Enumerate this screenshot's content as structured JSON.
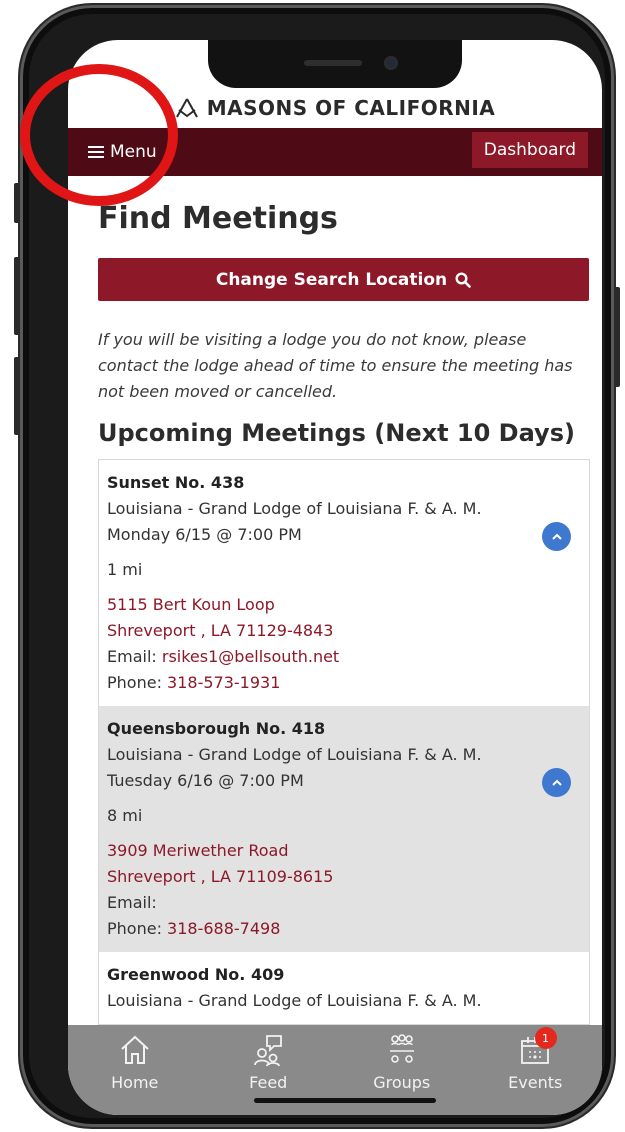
{
  "brand": {
    "logo_text": "MASONS OF CALIFORNIA",
    "accent": "#8c1828",
    "dark_accent": "#4f0b15"
  },
  "menu": {
    "menu_label": "Menu",
    "dashboard_label": "Dashboard"
  },
  "page": {
    "title": "Find Meetings",
    "change_location_label": "Change Search Location",
    "notice": "If you will be visiting a lodge you do not know, please contact the lodge ahead of time to ensure the meeting has not been moved or cancelled.",
    "section_title": "Upcoming Meetings (Next 10 Days)"
  },
  "meetings": [
    {
      "name": "Sunset No. 438",
      "jurisdiction": "Louisiana - Grand Lodge of Louisiana F. & A. M.",
      "when": "Monday 6/15 @ 7:00 PM",
      "distance": "1 mi",
      "address1": "5115 Bert Koun Loop",
      "address2": "Shreveport , LA 71129-4843",
      "email_label": "Email:",
      "email": "rsikes1@bellsouth.net",
      "phone_label": "Phone:",
      "phone": "318-573-1931"
    },
    {
      "name": "Queensborough No. 418",
      "jurisdiction": "Louisiana - Grand Lodge of Louisiana F. & A. M.",
      "when": "Tuesday 6/16 @ 7:00 PM",
      "distance": "8 mi",
      "address1": "3909 Meriwether Road",
      "address2": "Shreveport , LA 71109-8615",
      "email_label": "Email:",
      "email": "",
      "phone_label": "Phone:",
      "phone": "318-688-7498"
    },
    {
      "name": "Greenwood No. 409",
      "jurisdiction": "Louisiana - Grand Lodge of Louisiana F. & A. M."
    }
  ],
  "bottom_nav": [
    {
      "label": "Home",
      "icon": "home-icon"
    },
    {
      "label": "Feed",
      "icon": "feed-icon"
    },
    {
      "label": "Groups",
      "icon": "groups-icon"
    },
    {
      "label": "Events",
      "icon": "calendar-icon",
      "badge": "1"
    }
  ]
}
